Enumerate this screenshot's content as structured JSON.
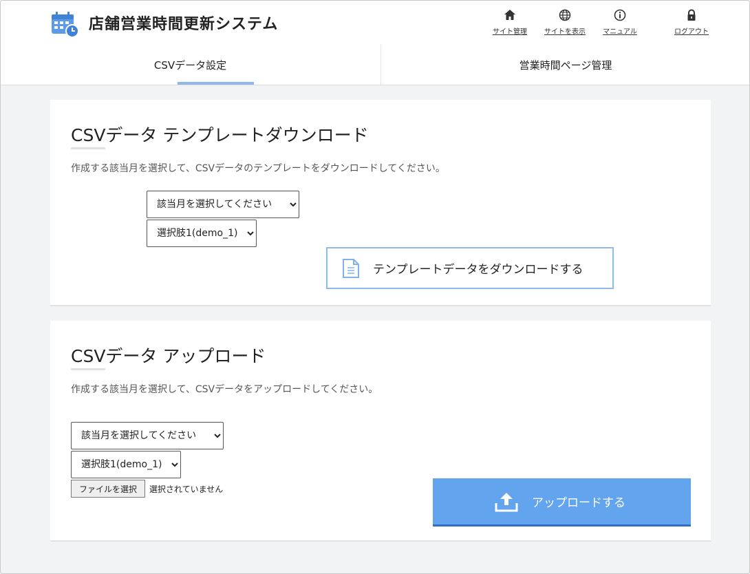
{
  "header": {
    "title": "店舗営業時間更新システム",
    "nav": [
      {
        "label": "サイト管理",
        "icon": "home-icon"
      },
      {
        "label": "サイトを表示",
        "icon": "globe-icon"
      },
      {
        "label": "マニュアル",
        "icon": "info-icon"
      },
      {
        "label": "ログアウト",
        "icon": "lock-icon"
      }
    ]
  },
  "tabs": [
    {
      "label": "CSVデータ設定",
      "active": true
    },
    {
      "label": "営業時間ページ管理",
      "active": false
    }
  ],
  "download": {
    "title": "CSVデータ テンプレートダウンロード",
    "description": "作成する該当月を選択して、CSVデータのテンプレートをダウンロードしてください。",
    "month_select": "該当月を選択してください",
    "option_select": "選択肢1(demo_1)",
    "button_label": "テンプレートデータをダウンロードする"
  },
  "upload": {
    "title": "CSVデータ アップロード",
    "description": "作成する該当月を選択して、CSVデータをアップロードしてください。",
    "month_select": "該当月を選択してください",
    "option_select": "選択肢1(demo_1)",
    "file_button": "ファイルを選択",
    "file_status": "選択されていません",
    "button_label": "アップロードする"
  },
  "colors": {
    "accent": "#63a4ef",
    "tab_underline": "#8fb8e8",
    "background": "#f1f3f4"
  }
}
